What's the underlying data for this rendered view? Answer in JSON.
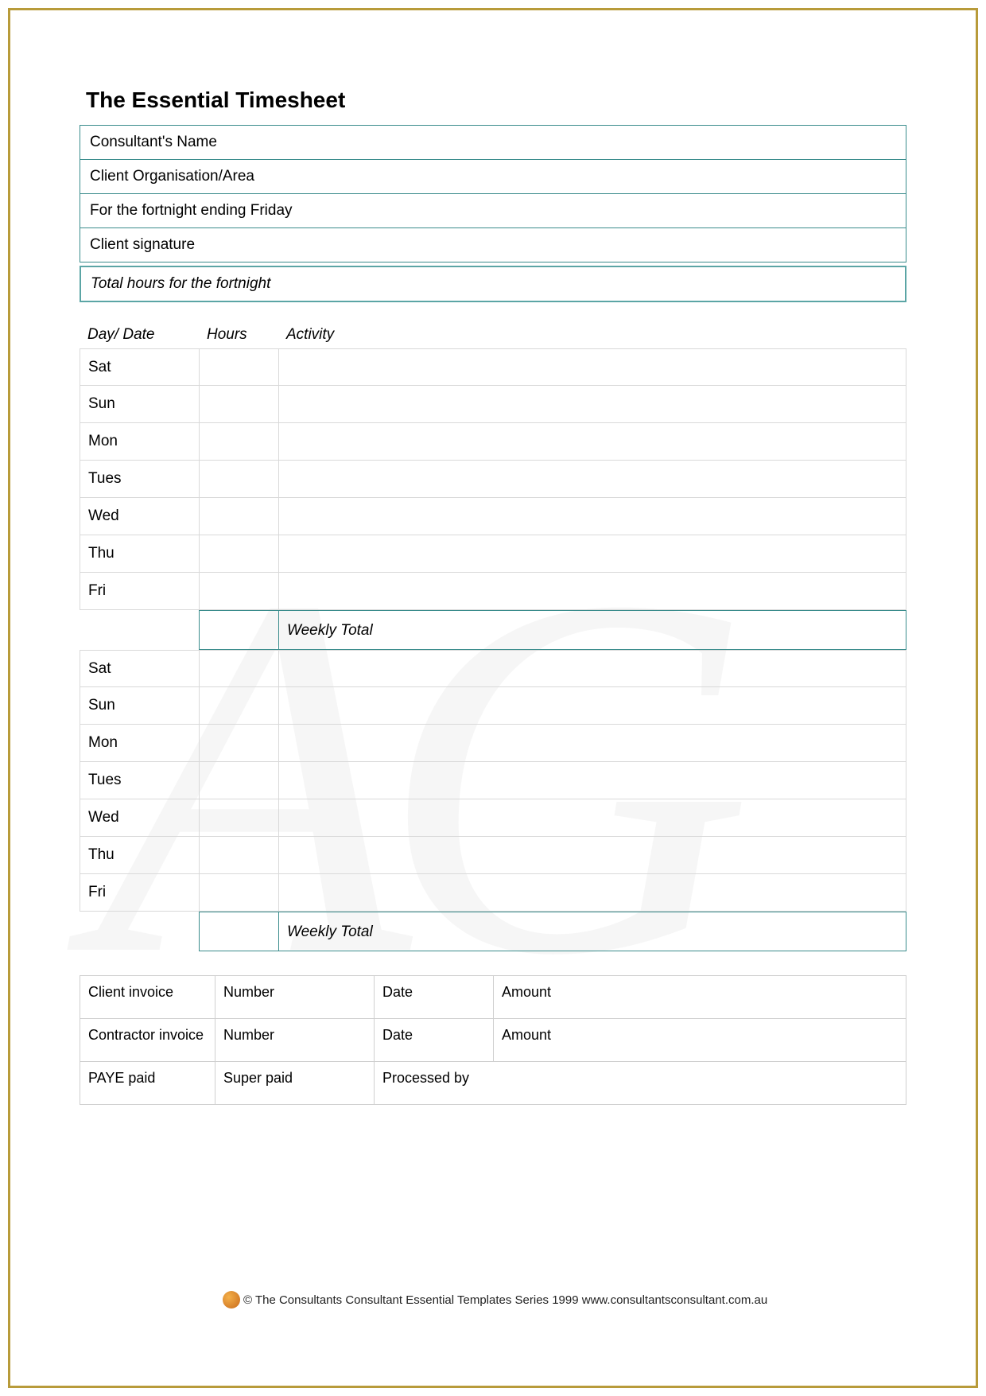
{
  "title": "The Essential Timesheet",
  "info": {
    "name_label": "Consultant's Name",
    "org_label": "Client Organisation/Area",
    "fortnight_label": "For the fortnight ending Friday",
    "signature_label": "Client signature",
    "total_label": "Total hours for the fortnight"
  },
  "table_headers": {
    "day": "Day/ Date",
    "hours": "Hours",
    "activity": "Activity"
  },
  "week1": [
    "Sat",
    "Sun",
    "Mon",
    "Tues",
    "Wed",
    "Thu",
    "Fri"
  ],
  "week2": [
    "Sat",
    "Sun",
    "Mon",
    "Tues",
    "Wed",
    "Thu",
    "Fri"
  ],
  "weekly_total_label": "Weekly Total",
  "invoice": {
    "r1c1": "Client invoice",
    "r1c2": "Number",
    "r1c3": "Date",
    "r1c4": "Amount",
    "r2c1": "Contractor invoice",
    "r2c2": "Number",
    "r2c3": "Date",
    "r2c4": "Amount",
    "r3c1": "PAYE paid",
    "r3c2": "Super paid",
    "r3c3": "Processed by"
  },
  "footer": "© The Consultants Consultant Essential Templates Series 1999 www.consultantsconsultant.com.au"
}
